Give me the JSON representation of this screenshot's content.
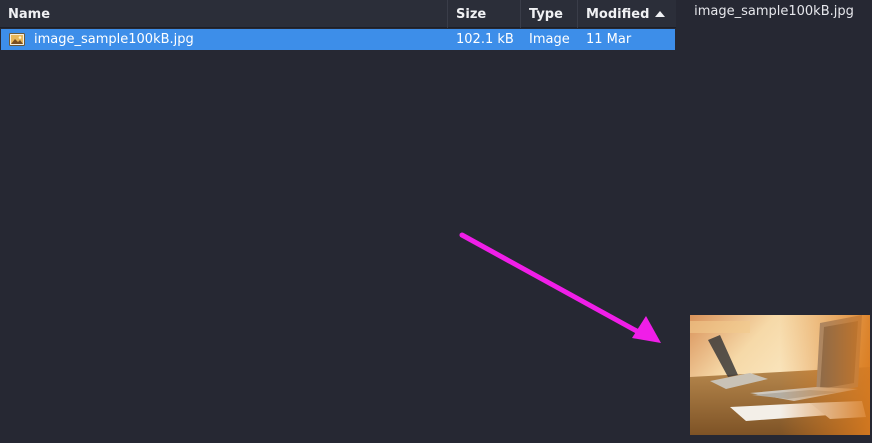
{
  "columns": {
    "name": "Name",
    "size": "Size",
    "type": "Type",
    "modified": "Modified"
  },
  "sort": {
    "column": "modified",
    "direction": "ascending",
    "icon": "sort-up-icon"
  },
  "files": [
    {
      "name": "image_sample100kB.jpg",
      "size": "102.1 kB",
      "type": "Image",
      "modified": "11 Mar",
      "icon": "image-file-icon",
      "selected": true
    }
  ],
  "preview": {
    "filename": "image_sample100kB.jpg"
  },
  "colors": {
    "selection": "#3d8ee9",
    "annotation_arrow": "#f01ee8",
    "background": "#262833"
  }
}
